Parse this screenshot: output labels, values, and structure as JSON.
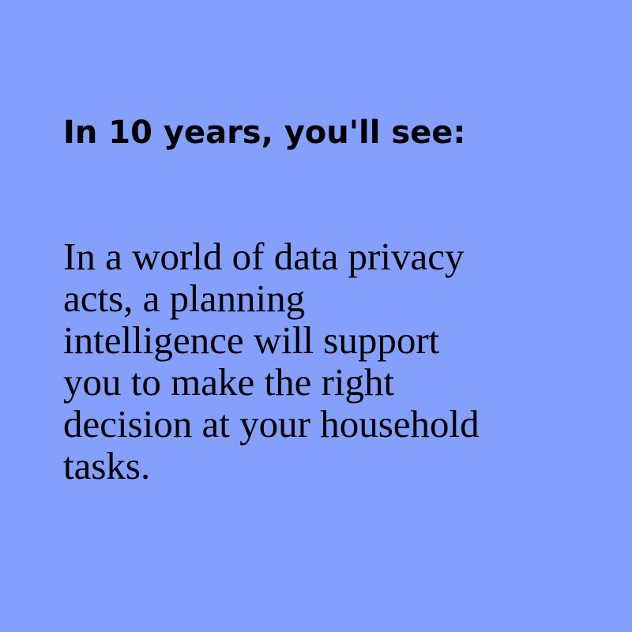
{
  "heading": "In 10 years, you'll see:",
  "body_lines": [
    "In a world of data privacy",
    "acts, a planning",
    "intelligence will support",
    "you to make the right",
    "decision at your household",
    "tasks."
  ],
  "colors": {
    "background": "#859ffc",
    "text": "#000000"
  }
}
